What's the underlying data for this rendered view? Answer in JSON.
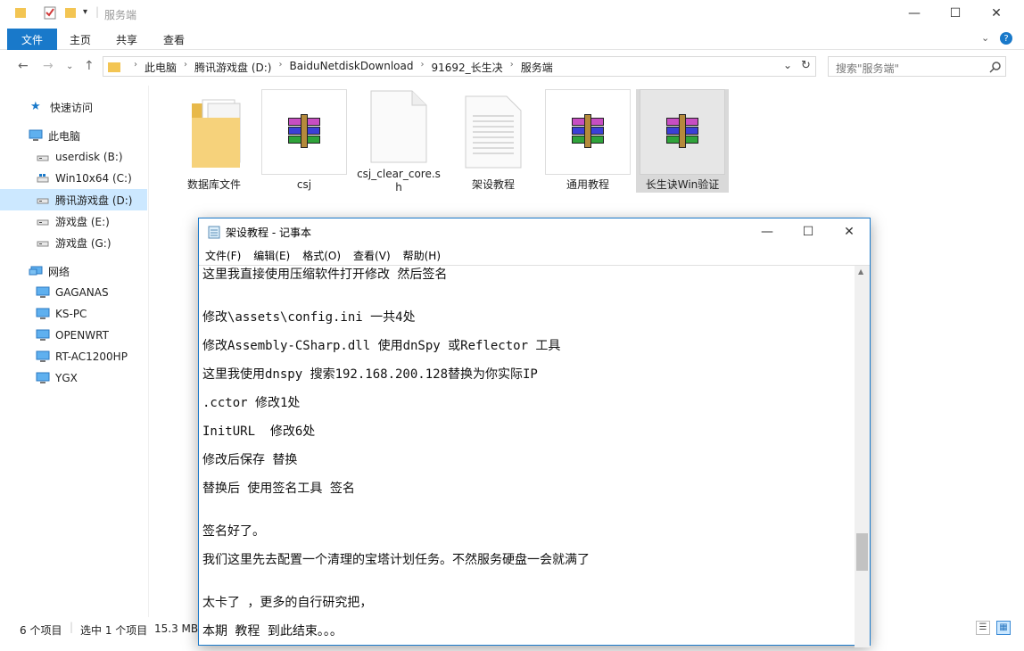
{
  "explorer": {
    "title": "服务端",
    "window_controls": {
      "minimize": "—",
      "maximize": "☐",
      "close": "✕"
    },
    "ribbon_tabs": [
      "文件",
      "主页",
      "共享",
      "查看"
    ],
    "address": {
      "crumbs": [
        "此电脑",
        "腾讯游戏盘 (D:)",
        "BaiduNetdiskDownload",
        "91692_长生决",
        "服务端"
      ]
    },
    "search": {
      "placeholder": "搜索\"服务端\""
    },
    "sidebar": {
      "items": [
        {
          "label": "快速访问",
          "icon": "star-icon"
        },
        {
          "label": "此电脑",
          "icon": "pc-icon"
        },
        {
          "label": "userdisk (B:)",
          "icon": "drive-icon"
        },
        {
          "label": "Win10x64 (C:)",
          "icon": "drive-icon"
        },
        {
          "label": "腾讯游戏盘 (D:)",
          "icon": "drive-icon",
          "selected": true
        },
        {
          "label": "游戏盘 (E:)",
          "icon": "drive-icon"
        },
        {
          "label": "游戏盘 (G:)",
          "icon": "drive-icon"
        },
        {
          "label": "网络",
          "icon": "network-icon"
        },
        {
          "label": "GAGANAS",
          "icon": "computer-icon"
        },
        {
          "label": "KS-PC",
          "icon": "computer-icon"
        },
        {
          "label": "OPENWRT",
          "icon": "computer-icon"
        },
        {
          "label": "RT-AC1200HP",
          "icon": "computer-icon"
        },
        {
          "label": "YGX",
          "icon": "computer-icon"
        }
      ]
    },
    "files": [
      {
        "label": "数据库文件",
        "icon": "folder-icon"
      },
      {
        "label": "csj",
        "icon": "winrar-icon"
      },
      {
        "label": "csj_clear_core.sh",
        "icon": "blank-file-icon"
      },
      {
        "label": "架设教程",
        "icon": "text-file-icon"
      },
      {
        "label": "通用教程",
        "icon": "winrar-icon"
      },
      {
        "label": "长生诀Win验证",
        "icon": "winrar-icon",
        "selected": true
      }
    ],
    "status": {
      "count": "6 个项目",
      "selection": "选中 1 个项目",
      "size": "15.3 MB"
    }
  },
  "notepad": {
    "title": "架设教程 - 记事本",
    "window_controls": {
      "minimize": "—",
      "maximize": "☐",
      "close": "✕"
    },
    "menu": [
      "文件(F)",
      "编辑(E)",
      "格式(O)",
      "查看(V)",
      "帮助(H)"
    ],
    "lines": [
      "这里我直接使用压缩软件打开修改 然后签名",
      "",
      "修改\\assets\\config.ini 一共4处",
      "修改Assembly-CSharp.dll 使用dnSpy 或Reflector 工具",
      "这里我使用dnspy 搜索192.168.200.128替换为你实际IP",
      ".cctor 修改1处",
      "InitURL  修改6处",
      "修改后保存 替换",
      "替换后 使用签名工具 签名",
      "",
      "签名好了。",
      "我们这里先去配置一个清理的宝塔计划任务。不然服务硬盘一会就满了",
      "",
      "太卡了 ，更多的自行研究把，",
      "本期 教程 到此结束。。。"
    ]
  }
}
